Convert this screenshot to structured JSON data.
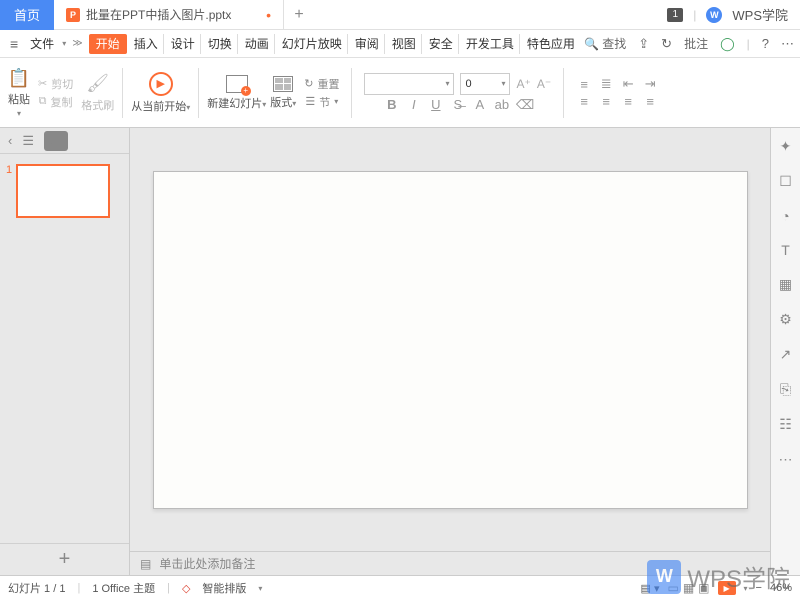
{
  "titlebar": {
    "home": "首页",
    "doc_name": "批量在PPT中插入图片.pptx",
    "badge": "1",
    "brand": "WPS学院"
  },
  "menubar": {
    "file": "文件",
    "tabs": [
      "开始",
      "插入",
      "设计",
      "切换",
      "动画",
      "幻灯片放映",
      "审阅",
      "视图",
      "安全",
      "开发工具",
      "特色应用"
    ],
    "search": "查找",
    "annotate": "批注"
  },
  "ribbon": {
    "paste": "粘贴",
    "cut": "剪切",
    "copy": "复制",
    "format_painter": "格式刷",
    "from_current": "从当前开始",
    "new_slide": "新建幻灯片",
    "layout": "版式",
    "reset": "重置",
    "section": "节",
    "font_size": "0"
  },
  "thumb": {
    "num": "1"
  },
  "notes": {
    "placeholder": "单击此处添加备注"
  },
  "status": {
    "slide_pos": "幻灯片 1 / 1",
    "theme": "1 Office 主题",
    "smart": "智能排版",
    "zoom": "46%"
  },
  "watermark": {
    "logo": "W",
    "text": "WPS学院"
  }
}
